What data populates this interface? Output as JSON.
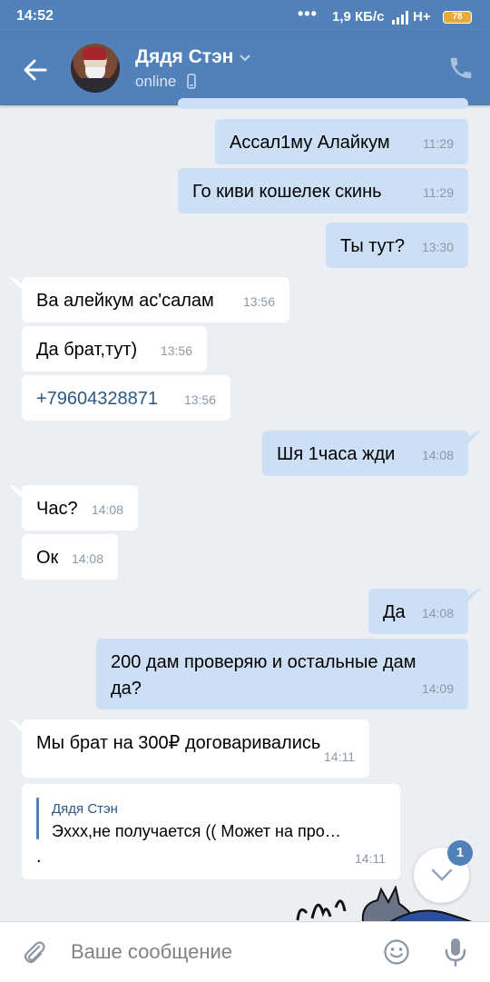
{
  "statusbar": {
    "time": "14:52",
    "dots": "•••",
    "speed": "1,9 КБ/с",
    "network": "H+",
    "battery": "78"
  },
  "header": {
    "name": "Дядя Стэн",
    "status": "online"
  },
  "messages": [
    {
      "dir": "out",
      "text": "Ассал1му Алайкум",
      "time": "11:29"
    },
    {
      "dir": "out",
      "text": "Го киви кошелек скинь",
      "time": "11:29"
    },
    {
      "dir": "out",
      "text": "Ты тут?",
      "time": "13:30"
    },
    {
      "dir": "in",
      "text": "Ва алейкум ас'салам",
      "time": "13:56"
    },
    {
      "dir": "in",
      "text": "Да брат,тут)",
      "time": "13:56"
    },
    {
      "dir": "in",
      "text": "+79604328871",
      "time": "13:56"
    },
    {
      "dir": "out",
      "text": "Шя 1часа жди",
      "time": "14:08"
    },
    {
      "dir": "in",
      "text": "Час?",
      "time": "14:08"
    },
    {
      "dir": "in",
      "text": "Ок",
      "time": "14:08"
    },
    {
      "dir": "out",
      "text": "Да",
      "time": "14:08"
    },
    {
      "dir": "out",
      "text_line1": "200 дам проверяю и остальные дам",
      "text_line2": "да?",
      "time": "14:09"
    },
    {
      "dir": "in",
      "text": "Мы брат на 300₽ договаривались",
      "time": "14:11"
    },
    {
      "dir": "in",
      "reply_name": "Дядя Стэн",
      "reply_text": "Эххх,не получается ((  Может на про…",
      "text": ".",
      "time": "14:11"
    }
  ],
  "scroll_badge": "1",
  "input": {
    "placeholder": "Ваше сообщение"
  },
  "colors": {
    "header": "#5181b8",
    "background": "#ebeef2",
    "outgoing_bubble": "#cddff4",
    "incoming_bubble": "#ffffff",
    "link": "#2a5885",
    "time": "#8a98a8"
  },
  "icons": [
    "back-arrow-icon",
    "chevron-down-icon",
    "mobile-phone-icon",
    "phone-icon",
    "paperclip-icon",
    "emoji-icon",
    "microphone-icon",
    "chevron-down-icon"
  ]
}
